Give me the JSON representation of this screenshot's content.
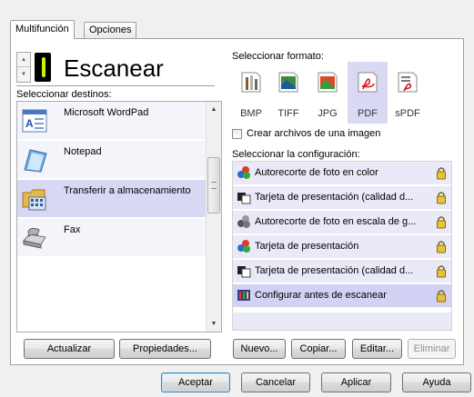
{
  "tabs": [
    "Multifunción",
    "Opciones"
  ],
  "profile_title": "Escanear",
  "destinations_label": "Seleccionar destinos:",
  "destinations": [
    {
      "label": "Microsoft WordPad",
      "selected": false
    },
    {
      "label": "Notepad",
      "selected": false
    },
    {
      "label": "Transferir a almacenamiento",
      "selected": true
    },
    {
      "label": "Fax",
      "selected": false
    }
  ],
  "left_buttons": {
    "update": "Actualizar",
    "properties": "Propiedades..."
  },
  "format_label": "Seleccionar formato:",
  "formats": [
    {
      "label": "BMP",
      "selected": false
    },
    {
      "label": "TIFF",
      "selected": false
    },
    {
      "label": "JPG",
      "selected": false
    },
    {
      "label": "PDF",
      "selected": true
    },
    {
      "label": "sPDF",
      "selected": false
    }
  ],
  "single_image_checkbox": "Crear archivos de una imagen",
  "config_label": "Seleccionar la configuración:",
  "configs": [
    {
      "label": "Autorecorte de foto en color",
      "icon": "color-photo-icon",
      "selected": false
    },
    {
      "label": "Tarjeta de presentación (calidad d...",
      "icon": "bw-card-icon",
      "selected": false
    },
    {
      "label": "Autorecorte de foto en escala de g...",
      "icon": "gray-photo-icon",
      "selected": false
    },
    {
      "label": "Tarjeta de presentación",
      "icon": "color-photo-icon",
      "selected": false
    },
    {
      "label": "Tarjeta de presentación (calidad d...",
      "icon": "bw-card-icon",
      "selected": false
    },
    {
      "label": "Configurar antes de escanear",
      "icon": "configure-icon",
      "selected": true
    }
  ],
  "config_buttons": {
    "new": "Nuevo...",
    "copy": "Copiar...",
    "edit": "Editar...",
    "delete": "Eliminar"
  },
  "dialog_buttons": {
    "accept": "Aceptar",
    "cancel": "Cancelar",
    "apply": "Aplicar",
    "help": "Ayuda"
  },
  "colors": {
    "selection": "#d8d8f5",
    "row": "#e9e9f8",
    "lcd": "#c6f500",
    "default_border": "#3c7fb1"
  }
}
